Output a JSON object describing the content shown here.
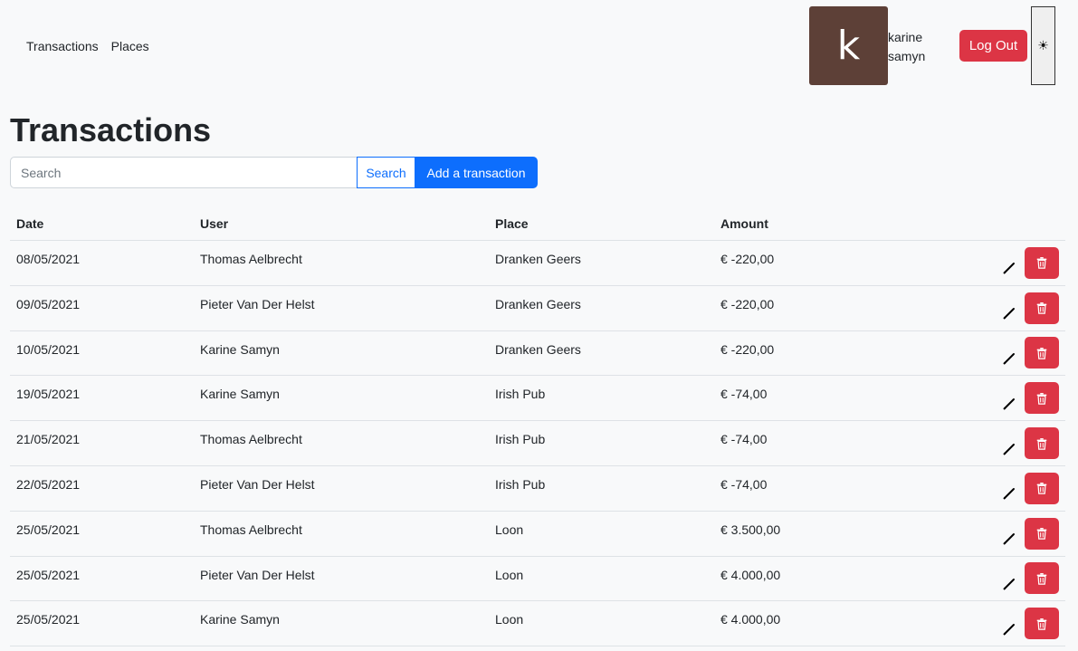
{
  "nav": {
    "links": [
      "Transactions",
      "Places"
    ]
  },
  "user": {
    "avatar_letter": "k",
    "first_name": "karine",
    "last_name": "samyn",
    "logout_label": "Log Out",
    "theme_icon": "sun-icon",
    "theme_glyph": "☀"
  },
  "page": {
    "title": "Transactions",
    "search_placeholder": "Search",
    "search_button": "Search",
    "add_button": "Add a transaction"
  },
  "table": {
    "headers": [
      "Date",
      "User",
      "Place",
      "Amount"
    ],
    "rows": [
      {
        "date": "08/05/2021",
        "user": "Thomas Aelbrecht",
        "place": "Dranken Geers",
        "amount": "€ -220,00"
      },
      {
        "date": "09/05/2021",
        "user": "Pieter Van Der Helst",
        "place": "Dranken Geers",
        "amount": "€ -220,00"
      },
      {
        "date": "10/05/2021",
        "user": "Karine Samyn",
        "place": "Dranken Geers",
        "amount": "€ -220,00"
      },
      {
        "date": "19/05/2021",
        "user": "Karine Samyn",
        "place": "Irish Pub",
        "amount": "€ -74,00"
      },
      {
        "date": "21/05/2021",
        "user": "Thomas Aelbrecht",
        "place": "Irish Pub",
        "amount": "€ -74,00"
      },
      {
        "date": "22/05/2021",
        "user": "Pieter Van Der Helst",
        "place": "Irish Pub",
        "amount": "€ -74,00"
      },
      {
        "date": "25/05/2021",
        "user": "Thomas Aelbrecht",
        "place": "Loon",
        "amount": "€ 3.500,00"
      },
      {
        "date": "25/05/2021",
        "user": "Pieter Van Der Helst",
        "place": "Loon",
        "amount": "€ 4.000,00"
      },
      {
        "date": "25/05/2021",
        "user": "Karine Samyn",
        "place": "Loon",
        "amount": "€ 4.000,00"
      }
    ]
  },
  "colors": {
    "danger": "#dc3545",
    "primary": "#0d6efd",
    "avatar_bg": "#5d4037",
    "background": "#f8f9fa"
  }
}
